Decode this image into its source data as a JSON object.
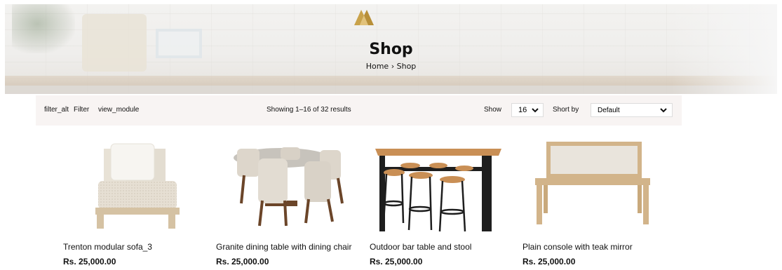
{
  "hero": {
    "title": "Shop",
    "breadcrumb": {
      "home": "Home",
      "separator": "›",
      "current": "Shop"
    },
    "logo_icon": "brand-mountain-logo",
    "accent_color": "#c9a24a"
  },
  "toolbar": {
    "filter_icon_name": "filter_alt",
    "filter_label": "Filter",
    "view_icon_name": "view_module",
    "results_text": "Showing 1–16 of 32 results",
    "show_label": "Show",
    "per_page_value": "16",
    "sort_label": "Short by",
    "sort_value": "Default"
  },
  "products": [
    {
      "name": "Trenton modular sofa_3",
      "price": "Rs. 25,000.00",
      "image": "modular-sofa-image"
    },
    {
      "name": "Granite dining table with dining chair",
      "price": "Rs. 25,000.00",
      "image": "dining-set-image"
    },
    {
      "name": "Outdoor bar table and stool",
      "price": "Rs. 25,000.00",
      "image": "bar-table-image"
    },
    {
      "name": "Plain console with teak mirror",
      "price": "Rs. 25,000.00",
      "image": "console-mirror-image"
    }
  ]
}
